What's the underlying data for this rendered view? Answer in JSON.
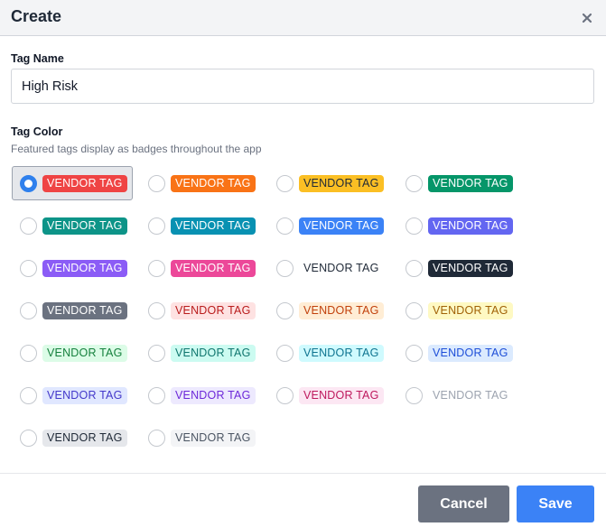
{
  "dialog": {
    "title": "Create"
  },
  "tag_name": {
    "label": "Tag Name",
    "value": "High Risk"
  },
  "tag_color": {
    "label": "Tag Color",
    "help": "Featured tags display as badges throughout the app",
    "selected_index": 0,
    "options": [
      {
        "label": "VENDOR TAG",
        "bg": "#ef4444",
        "fg": "#ffffff"
      },
      {
        "label": "VENDOR TAG",
        "bg": "#f97316",
        "fg": "#ffffff"
      },
      {
        "label": "VENDOR TAG",
        "bg": "#fbbf24",
        "fg": "#1f2937"
      },
      {
        "label": "VENDOR TAG",
        "bg": "#059669",
        "fg": "#ffffff"
      },
      {
        "label": "VENDOR TAG",
        "bg": "#0d9488",
        "fg": "#ffffff"
      },
      {
        "label": "VENDOR TAG",
        "bg": "#0891b2",
        "fg": "#ffffff"
      },
      {
        "label": "VENDOR TAG",
        "bg": "#3b82f6",
        "fg": "#ffffff"
      },
      {
        "label": "VENDOR TAG",
        "bg": "#6366f1",
        "fg": "#ffffff"
      },
      {
        "label": "VENDOR TAG",
        "bg": "#8b5cf6",
        "fg": "#ffffff"
      },
      {
        "label": "VENDOR TAG",
        "bg": "#ec4899",
        "fg": "#ffffff"
      },
      {
        "label": "VENDOR TAG",
        "bg": "#ffffff",
        "fg": "#1f2937"
      },
      {
        "label": "VENDOR TAG",
        "bg": "#1f2937",
        "fg": "#ffffff"
      },
      {
        "label": "VENDOR TAG",
        "bg": "#6b7280",
        "fg": "#ffffff"
      },
      {
        "label": "VENDOR TAG",
        "bg": "#fee2e2",
        "fg": "#b91c1c"
      },
      {
        "label": "VENDOR TAG",
        "bg": "#ffedd5",
        "fg": "#c2410c"
      },
      {
        "label": "VENDOR TAG",
        "bg": "#fef9c3",
        "fg": "#a16207"
      },
      {
        "label": "VENDOR TAG",
        "bg": "#dcfce7",
        "fg": "#15803d"
      },
      {
        "label": "VENDOR TAG",
        "bg": "#ccfbf1",
        "fg": "#0f766e"
      },
      {
        "label": "VENDOR TAG",
        "bg": "#cffafe",
        "fg": "#0e7490"
      },
      {
        "label": "VENDOR TAG",
        "bg": "#dbeafe",
        "fg": "#1d4ed8"
      },
      {
        "label": "VENDOR TAG",
        "bg": "#e0e7ff",
        "fg": "#4338ca"
      },
      {
        "label": "VENDOR TAG",
        "bg": "#ede9fe",
        "fg": "#6d28d9"
      },
      {
        "label": "VENDOR TAG",
        "bg": "#fce7f3",
        "fg": "#be185d"
      },
      {
        "label": "VENDOR TAG",
        "bg": "#ffffff",
        "fg": "#9ca3af"
      },
      {
        "label": "VENDOR TAG",
        "bg": "#e5e7eb",
        "fg": "#1f2937"
      },
      {
        "label": "VENDOR TAG",
        "bg": "#f3f4f6",
        "fg": "#4b5563"
      }
    ]
  },
  "footer": {
    "cancel_label": "Cancel",
    "save_label": "Save"
  }
}
